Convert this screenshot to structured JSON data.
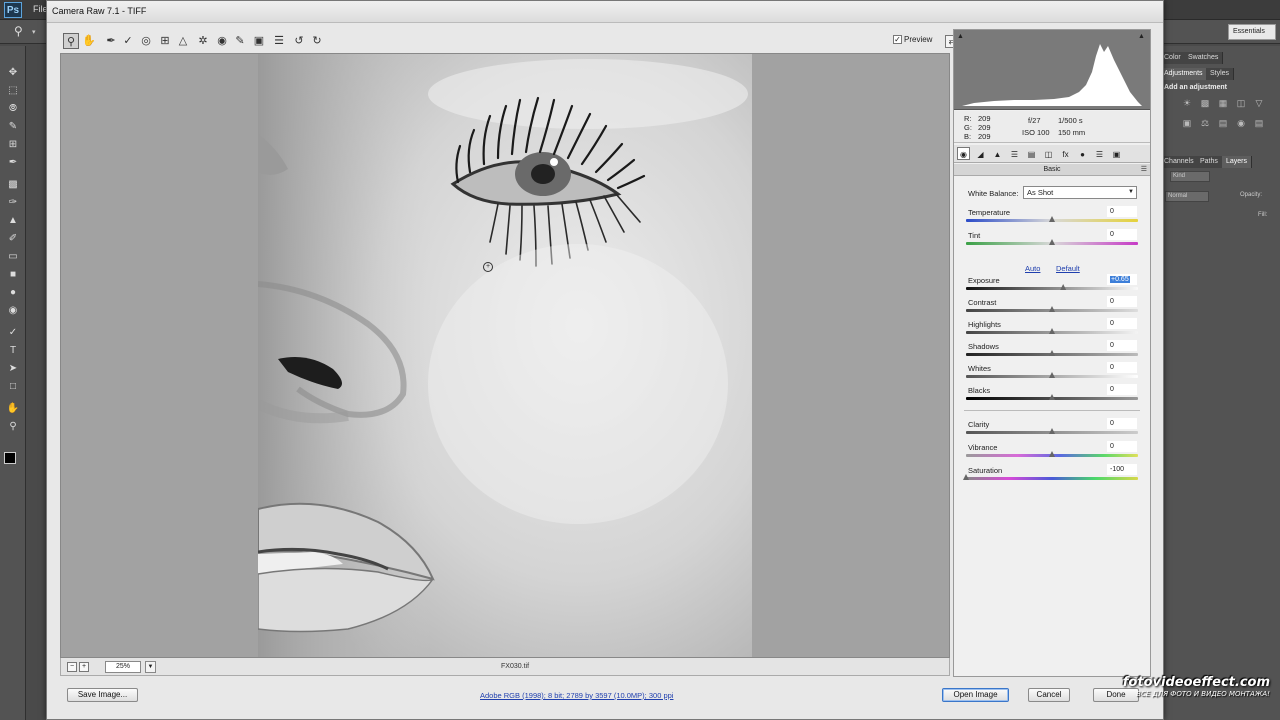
{
  "ps": {
    "logo": "Ps",
    "menu_first": "File",
    "workspace": "Essentials",
    "panel_tabs_top": [
      "Color",
      "Swatches"
    ],
    "panel_tabs_adj": [
      "Adjustments",
      "Styles"
    ],
    "add_adjustment": "Add an adjustment",
    "panel_tabs_layers": [
      "Channels",
      "Paths",
      "Layers"
    ],
    "kind": "Kind",
    "blend_mode": "Normal",
    "opacity_label": "Opacity:",
    "fill_label": "Fill:"
  },
  "acr": {
    "title": "Camera Raw 7.1  -  TIFF",
    "preview_label": "Preview",
    "preview_checked": true,
    "zoom": "25%",
    "file_name": "FX030.tif",
    "readout": {
      "r": "209",
      "g": "209",
      "b": "209",
      "r_label": "R:",
      "g_label": "G:",
      "b_label": "B:",
      "aperture": "f/27",
      "shutter": "1/500 s",
      "iso": "ISO 100",
      "focal": "150 mm"
    },
    "panel_title": "Basic",
    "white_balance_label": "White Balance:",
    "white_balance_value": "As Shot",
    "auto": "Auto",
    "default": "Default",
    "sliders": [
      {
        "label": "Temperature",
        "value": "0",
        "fraction": 0.5
      },
      {
        "label": "Tint",
        "value": "0",
        "fraction": 0.5
      },
      {
        "label": "Exposure",
        "value": "+0.65",
        "fraction": 0.565
      },
      {
        "label": "Contrast",
        "value": "0",
        "fraction": 0.5
      },
      {
        "label": "Highlights",
        "value": "0",
        "fraction": 0.5
      },
      {
        "label": "Shadows",
        "value": "0",
        "fraction": 0.5
      },
      {
        "label": "Whites",
        "value": "0",
        "fraction": 0.5
      },
      {
        "label": "Blacks",
        "value": "0",
        "fraction": 0.5
      },
      {
        "label": "Clarity",
        "value": "0",
        "fraction": 0.5
      },
      {
        "label": "Vibrance",
        "value": "0",
        "fraction": 0.5
      },
      {
        "label": "Saturation",
        "value": "-100",
        "fraction": 0.0
      }
    ],
    "buttons": {
      "save_image": "Save Image...",
      "open_image": "Open Image",
      "cancel": "Cancel",
      "done": "Done"
    },
    "workflow": "Adobe RGB (1998); 8 bit; 2789 by 3597 (10.0MP); 300 ppi",
    "tool_icons": [
      "zoom-icon",
      "hand-icon",
      "white-balance-icon",
      "color-sampler-icon",
      "target-adjust-icon",
      "crop-icon",
      "straighten-icon",
      "spot-removal-icon",
      "red-eye-icon",
      "adjustment-brush-icon",
      "graduated-filter-icon",
      "radial-icon",
      "preferences-icon",
      "rotate-left-icon",
      "rotate-right-icon"
    ]
  },
  "watermark": {
    "main": "fotovideoeffect.com",
    "sub": "ВСЕ ДЛЯ ФОТО И ВИДЕО МОНТАЖА!"
  }
}
